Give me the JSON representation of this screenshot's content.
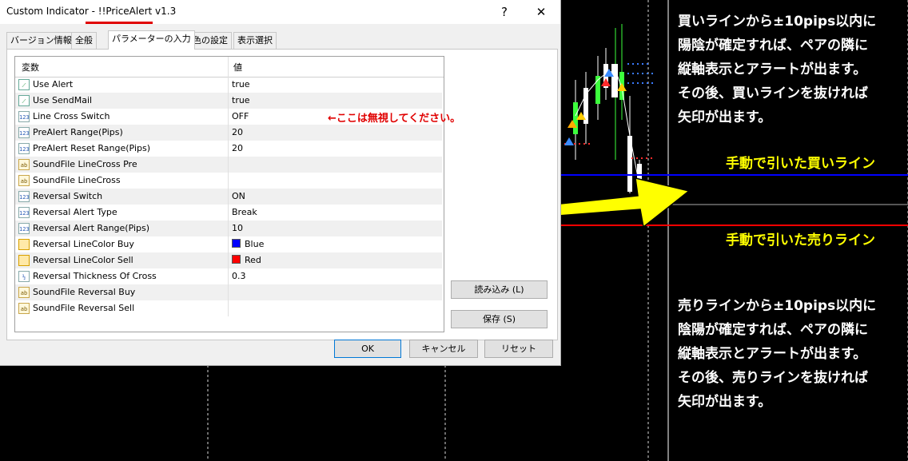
{
  "dialog": {
    "title_prefix": "Custom Indicator - ",
    "title_name": "!!PriceAlert v1.3",
    "help_glyph": "?",
    "close_glyph": "✕",
    "tabs": [
      {
        "label": "バージョン情報",
        "active": false
      },
      {
        "label": "全般",
        "active": false
      },
      {
        "label": "パラメーターの入力",
        "active": true
      },
      {
        "label": "色の設定",
        "active": false
      },
      {
        "label": "表示選択",
        "active": false
      }
    ],
    "columns": {
      "variable": "変数",
      "value": "値"
    },
    "params": [
      {
        "icon": "bool-icon",
        "name": "Use Alert",
        "value": "true"
      },
      {
        "icon": "bool-icon",
        "name": "Use SendMail",
        "value": "true"
      },
      {
        "icon": "int-icon",
        "name": "Line Cross Switch",
        "value": "OFF"
      },
      {
        "icon": "int-icon",
        "name": "PreAlert Range(Pips)",
        "value": "20"
      },
      {
        "icon": "int-icon",
        "name": "PreAlert Reset Range(Pips)",
        "value": "20"
      },
      {
        "icon": "string-icon",
        "name": "SoundFile LineCross Pre",
        "value": ""
      },
      {
        "icon": "string-icon",
        "name": "SoundFile LineCross",
        "value": ""
      },
      {
        "icon": "int-icon",
        "name": "Reversal Switch",
        "value": "ON"
      },
      {
        "icon": "int-icon",
        "name": "Reversal Alert Type",
        "value": "Break"
      },
      {
        "icon": "int-icon",
        "name": "Reversal Alert Range(Pips)",
        "value": "10"
      },
      {
        "icon": "color-icon",
        "name": "Reversal LineColor Buy",
        "value": "Blue",
        "swatch": "#0000ff"
      },
      {
        "icon": "color-icon",
        "name": "Reversal LineColor Sell",
        "value": "Red",
        "swatch": "#ff0000"
      },
      {
        "icon": "double-icon",
        "name": "Reversal Thickness Of Cross",
        "value": "0.3"
      },
      {
        "icon": "string-icon",
        "name": "SoundFile Reversal Buy",
        "value": ""
      },
      {
        "icon": "string-icon",
        "name": "SoundFile Reversal Sell",
        "value": ""
      }
    ],
    "icon_text": {
      "bool-icon": "⟋",
      "int-icon": "123",
      "string-icon": "ab",
      "color-icon": "",
      "double-icon": "½"
    },
    "buttons": {
      "load": "読み込み (L)",
      "save": "保存 (S)",
      "ok": "OK",
      "cancel": "キャンセル",
      "reset": "リセット"
    }
  },
  "annotations": {
    "ignore_note": "←ここは無視してください。",
    "buy_text": [
      "買いラインから±10pips以内に",
      "陽陰が確定すれば、ペアの隣に",
      "縦軸表示とアラートが出ます。",
      "その後、買いラインを抜ければ",
      "矢印が出ます。"
    ],
    "buy_line_label": "手動で引いた買いライン",
    "sell_line_label": "手動で引いた売りライン",
    "sell_text": [
      "売りラインから±10pips以内に",
      "陰陽が確定すれば、ペアの隣に",
      "縦軸表示とアラートが出ます。",
      "その後、売りラインを抜ければ",
      "矢印が出ます。"
    ]
  },
  "colors": {
    "buy_line": "#0000ff",
    "sell_line": "#ff0000",
    "arrow": "#ffff00",
    "title_underline": "#e00000",
    "annotation_text": "#ffffff",
    "annotation_label": "#ffff00",
    "note_text": "#e00000"
  }
}
